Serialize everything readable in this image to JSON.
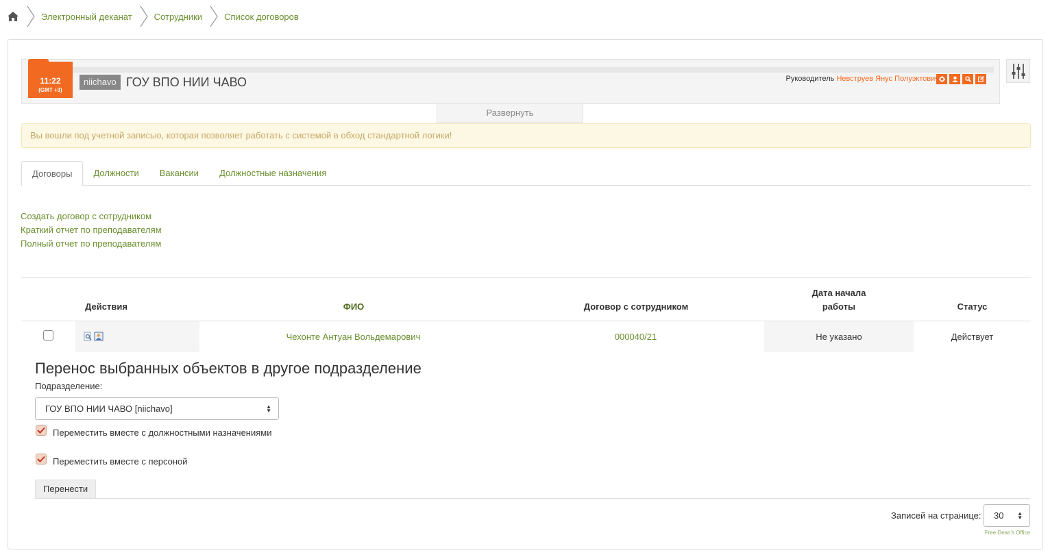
{
  "breadcrumb": {
    "items": [
      "Электронный деканат",
      "Сотрудники",
      "Список договоров"
    ]
  },
  "header": {
    "clock_time": "11:22",
    "clock_tz": "(GMT +3)",
    "org_code": "niichavo",
    "org_title": "ГОУ ВПО НИИ ЧАВО",
    "manager_label": "Руководитель",
    "manager_name": "Невструев Янус Полуэктович",
    "expand_label": "Развернуть"
  },
  "warning": "Вы вошли под учетной записью, которая позволяет работать с системой в обход стандартной логики!",
  "tabs": [
    {
      "label": "Договоры",
      "active": true
    },
    {
      "label": "Должности"
    },
    {
      "label": "Вакансии"
    },
    {
      "label": "Должностные назначения"
    }
  ],
  "links": [
    "Создать договор с сотрудником",
    "Краткий отчет по преподавателям",
    "Полный отчет по преподавателям"
  ],
  "table": {
    "headers": {
      "actions": "Действия",
      "fio": "ФИО",
      "contract": "Договор с сотрудником",
      "start_date_line1": "Дата начала",
      "start_date_line2": "работы",
      "status": "Статус"
    },
    "rows": [
      {
        "fio": "Чехонте Антуан Вольдемарович",
        "contract": "000040/21",
        "start_date": "Не указано",
        "status": "Действует"
      }
    ]
  },
  "transfer": {
    "title": "Перенос выбранных объектов в другое подразделение",
    "dept_label": "Подразделение:",
    "dept_value": "ГОУ ВПО НИИ ЧАВО [niichavo]",
    "option1": "Переместить вместе с должностными назначениями",
    "option2": "Переместить вместе с персоной",
    "button": "Перенести"
  },
  "pagination": {
    "label": "Записей на странице:",
    "value": "30"
  },
  "footer": "Free Dean's Office",
  "colors": {
    "accent": "#f26a21",
    "link": "#6a8f2e",
    "warning_bg": "#fcf8e3"
  }
}
